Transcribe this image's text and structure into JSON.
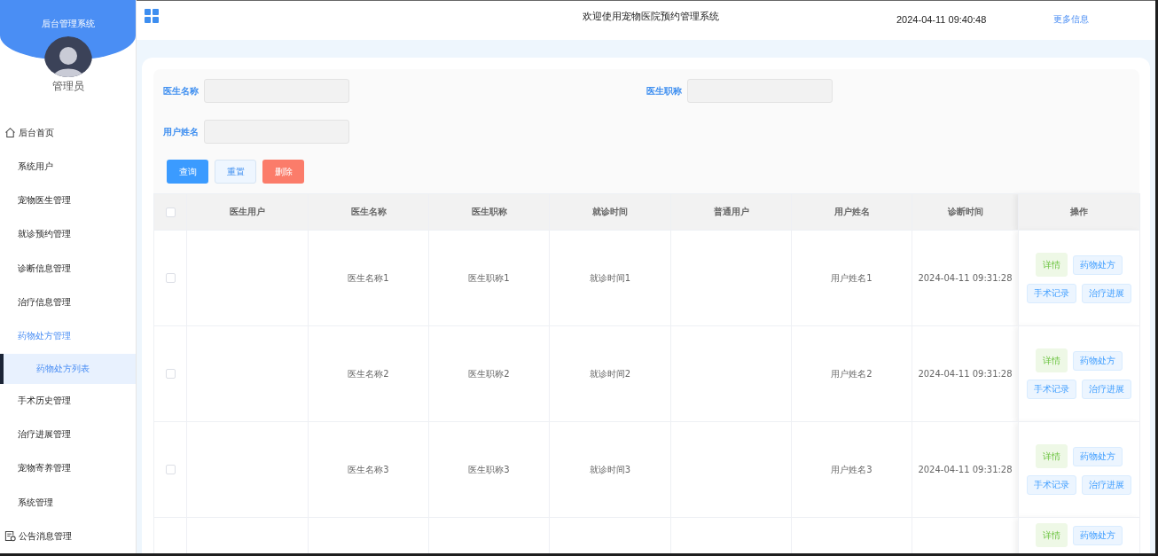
{
  "sidebar": {
    "title": "后台管理系统",
    "user": "管理员",
    "items": [
      {
        "label": "后台首页",
        "kind": "home",
        "expanded": false,
        "selected": false
      },
      {
        "label": "系统用户",
        "kind": "plain",
        "expanded": false,
        "selected": false
      },
      {
        "label": "宠物医生管理",
        "kind": "plain",
        "expanded": false,
        "selected": false
      },
      {
        "label": "就诊预约管理",
        "kind": "plain",
        "expanded": false,
        "selected": false
      },
      {
        "label": "诊断信息管理",
        "kind": "plain",
        "expanded": false,
        "selected": false
      },
      {
        "label": "治疗信息管理",
        "kind": "plain",
        "expanded": false,
        "selected": false
      },
      {
        "label": "药物处方管理",
        "kind": "plain",
        "expanded": true,
        "selected": false,
        "children": [
          {
            "label": "药物处方列表",
            "selected": true
          }
        ]
      },
      {
        "label": "手术历史管理",
        "kind": "plain",
        "expanded": false,
        "selected": false
      },
      {
        "label": "治疗进展管理",
        "kind": "plain",
        "expanded": false,
        "selected": false
      },
      {
        "label": "宠物寄养管理",
        "kind": "plain",
        "expanded": false,
        "selected": false
      },
      {
        "label": "系统管理",
        "kind": "plain",
        "expanded": false,
        "selected": false
      },
      {
        "label": "公告消息管理",
        "kind": "notice",
        "expanded": false,
        "selected": false
      }
    ]
  },
  "header": {
    "title": "欢迎使用宠物医院预约管理系统",
    "datetime": "2024-04-11 09:40:48",
    "link": "更多信息"
  },
  "search": {
    "fields": [
      {
        "label": "医生名称"
      },
      {
        "label": "医生职称"
      },
      {
        "label": "用户姓名"
      }
    ],
    "buttons": [
      {
        "label": "查询",
        "kind": "primary"
      },
      {
        "label": "重置",
        "kind": "plain"
      },
      {
        "label": "删除",
        "kind": "danger"
      }
    ]
  },
  "table": {
    "select_all": {
      "checked": false
    },
    "columns": [
      "医生用户",
      "医生名称",
      "医生职称",
      "就诊时间",
      "普通用户",
      "用户姓名",
      "诊断时间",
      "操作"
    ],
    "rows": [
      {
        "checked": false,
        "cells": [
          null,
          "医生名称1",
          "医生职称1",
          "就诊时间1",
          null,
          "用户姓名1",
          "2024-04-11 09:31:28"
        ],
        "actions": [
          {
            "label": "详情",
            "kind": "success"
          },
          {
            "label": "药物处方",
            "kind": "primary"
          },
          {
            "label": "手术记录",
            "kind": "primary"
          },
          {
            "label": "治疗进展",
            "kind": "primary"
          }
        ]
      },
      {
        "checked": false,
        "cells": [
          null,
          "医生名称2",
          "医生职称2",
          "就诊时间2",
          null,
          "用户姓名2",
          "2024-04-11 09:31:28"
        ],
        "actions": [
          {
            "label": "详情",
            "kind": "success"
          },
          {
            "label": "药物处方",
            "kind": "primary"
          },
          {
            "label": "手术记录",
            "kind": "primary"
          },
          {
            "label": "治疗进展",
            "kind": "primary"
          }
        ]
      },
      {
        "checked": false,
        "cells": [
          null,
          "医生名称3",
          "医生职称3",
          "就诊时间3",
          null,
          "用户姓名3",
          "2024-04-11 09:31:28"
        ],
        "actions": [
          {
            "label": "详情",
            "kind": "success"
          },
          {
            "label": "药物处方",
            "kind": "primary"
          },
          {
            "label": "手术记录",
            "kind": "primary"
          },
          {
            "label": "治疗进展",
            "kind": "primary"
          }
        ]
      },
      {
        "cells": [
          null,
          null,
          null,
          null,
          null,
          null,
          null
        ],
        "actions": [
          {
            "label": "详情",
            "kind": "success"
          },
          {
            "label": "药物处方",
            "kind": "primary"
          }
        ]
      }
    ]
  }
}
